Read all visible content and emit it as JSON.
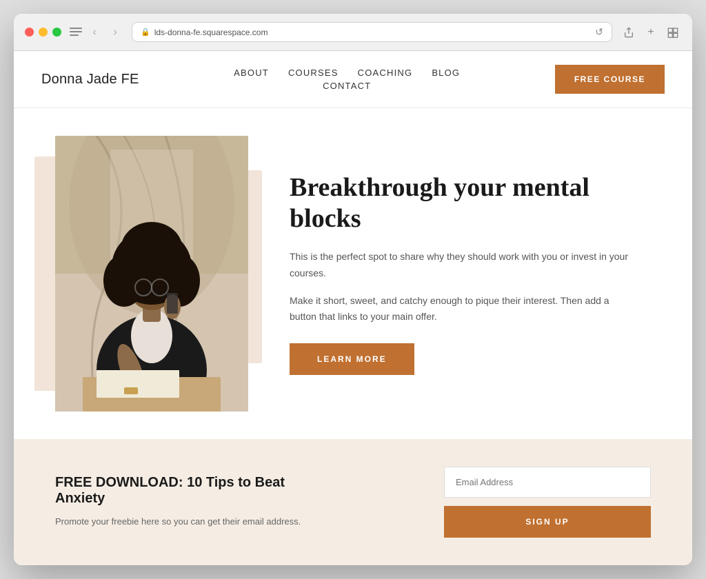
{
  "browser": {
    "url": "lds-donna-fe.squarespace.com",
    "back_label": "‹",
    "forward_label": "›",
    "reload_label": "↺"
  },
  "header": {
    "logo": "Donna Jade FE",
    "nav": {
      "items": [
        {
          "label": "ABOUT",
          "row": 1
        },
        {
          "label": "COURSES",
          "row": 1
        },
        {
          "label": "COACHING",
          "row": 1
        },
        {
          "label": "BLOG",
          "row": 1
        },
        {
          "label": "CONTACT",
          "row": 2
        }
      ]
    },
    "cta_button": "FREE COURSE"
  },
  "hero": {
    "title": "Breakthrough your mental blocks",
    "description1": "This is the perfect spot to share why they should work with you or invest in your courses.",
    "description2": "Make it short, sweet, and catchy enough to pique their interest. Then add a button that links to your main offer.",
    "learn_more_label": "LEARN MORE"
  },
  "download": {
    "title": "FREE DOWNLOAD: 10 Tips to Beat Anxiety",
    "description": "Promote your freebie here so you can get their email address.",
    "email_placeholder": "Email Address",
    "signup_label": "SIGN UP"
  },
  "colors": {
    "accent": "#c07030",
    "bg_peach": "#f2e4d8",
    "bg_section": "#f5ede4",
    "text_dark": "#1a1a1a",
    "text_mid": "#555",
    "text_light": "#aaa"
  }
}
